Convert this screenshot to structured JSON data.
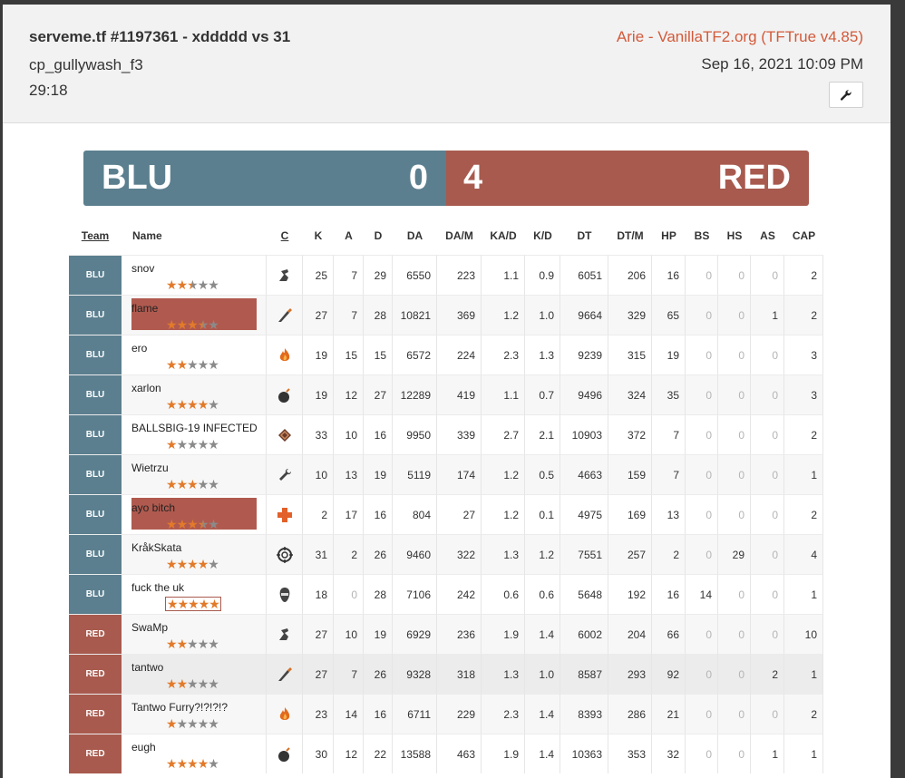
{
  "header": {
    "title": "serveme.tf #1197361 - xddddd vs 31",
    "map": "cp_gullywash_f3",
    "duration": "29:18",
    "server": "Arie - VanillaTF2.org (TFTrue v4.85)",
    "date": "Sep 16, 2021 10:09 PM",
    "tool_icon": "wrench-icon"
  },
  "score": {
    "blu_label": "BLU",
    "blu_score": "0",
    "red_score": "4",
    "red_label": "RED",
    "blu_color": "#5b7f8f",
    "red_color": "#a85a4e"
  },
  "columns": [
    "Team",
    "Name",
    "C",
    "K",
    "A",
    "D",
    "DA",
    "DA/M",
    "KA/D",
    "K/D",
    "DT",
    "DT/M",
    "HP",
    "BS",
    "HS",
    "AS",
    "CAP"
  ],
  "players": [
    {
      "team": "BLU",
      "name": "snov",
      "stars": 2.5,
      "cls": "scout-icon",
      "stats": [
        "25",
        "7",
        "29",
        "6550",
        "223",
        "1.1",
        "0.9",
        "6051",
        "206",
        "16",
        "0",
        "0",
        "0",
        "2"
      ]
    },
    {
      "team": "BLU",
      "name": "flame",
      "stars": 3.5,
      "cls": "soldier-icon",
      "stats": [
        "27",
        "7",
        "28",
        "10821",
        "369",
        "1.2",
        "1.0",
        "9664",
        "329",
        "65",
        "0",
        "0",
        "1",
        "2"
      ]
    },
    {
      "team": "BLU",
      "name": "ero",
      "stars": 2,
      "cls": "pyro-icon",
      "stats": [
        "19",
        "15",
        "15",
        "6572",
        "224",
        "2.3",
        "1.3",
        "9239",
        "315",
        "19",
        "0",
        "0",
        "0",
        "3"
      ]
    },
    {
      "team": "BLU",
      "name": "xarlon",
      "stars": 4,
      "cls": "demoman-icon",
      "stats": [
        "19",
        "12",
        "27",
        "12289",
        "419",
        "1.1",
        "0.7",
        "9496",
        "324",
        "35",
        "0",
        "0",
        "0",
        "3"
      ]
    },
    {
      "team": "BLU",
      "name": "BALLSBIG-19 INFECTED",
      "stars": 1,
      "cls": "heavy-icon",
      "stats": [
        "33",
        "10",
        "16",
        "9950",
        "339",
        "2.7",
        "2.1",
        "10903",
        "372",
        "7",
        "0",
        "0",
        "0",
        "2"
      ]
    },
    {
      "team": "BLU",
      "name": "Wietrzu",
      "stars": 3,
      "cls": "engineer-icon",
      "stats": [
        "10",
        "13",
        "19",
        "5119",
        "174",
        "1.2",
        "0.5",
        "4663",
        "159",
        "7",
        "0",
        "0",
        "0",
        "1"
      ]
    },
    {
      "team": "BLU",
      "name": "ayo bitch",
      "stars": 3.5,
      "cls": "medic-icon",
      "stats": [
        "2",
        "17",
        "16",
        "804",
        "27",
        "1.2",
        "0.1",
        "4975",
        "169",
        "13",
        "0",
        "0",
        "0",
        "2"
      ]
    },
    {
      "team": "BLU",
      "name": "KråkSkata",
      "stars": 4,
      "cls": "sniper-icon",
      "stats": [
        "31",
        "2",
        "26",
        "9460",
        "322",
        "1.3",
        "1.2",
        "7551",
        "257",
        "2",
        "0",
        "29",
        "0",
        "4"
      ]
    },
    {
      "team": "BLU",
      "name": "fuck the uk",
      "stars": 5,
      "cls": "spy-icon",
      "stats": [
        "18",
        "0",
        "28",
        "7106",
        "242",
        "0.6",
        "0.6",
        "5648",
        "192",
        "16",
        "14",
        "0",
        "0",
        "1"
      ]
    },
    {
      "team": "RED",
      "name": "SwaMp",
      "stars": 2,
      "cls": "scout-icon",
      "stats": [
        "27",
        "10",
        "19",
        "6929",
        "236",
        "1.9",
        "1.4",
        "6002",
        "204",
        "66",
        "0",
        "0",
        "0",
        "10"
      ]
    },
    {
      "team": "RED",
      "name": "tantwo",
      "stars": 2,
      "cls": "soldier-icon",
      "stats": [
        "27",
        "7",
        "26",
        "9328",
        "318",
        "1.3",
        "1.0",
        "8587",
        "293",
        "92",
        "0",
        "0",
        "2",
        "1"
      ]
    },
    {
      "team": "RED",
      "name": "Tantwo Furry?!?!?!?",
      "stars": 1,
      "cls": "pyro-icon",
      "stats": [
        "23",
        "14",
        "16",
        "6711",
        "229",
        "2.3",
        "1.4",
        "8393",
        "286",
        "21",
        "0",
        "0",
        "0",
        "2"
      ]
    },
    {
      "team": "RED",
      "name": "eugh",
      "stars": 4,
      "cls": "demoman-icon",
      "stats": [
        "30",
        "12",
        "22",
        "13588",
        "463",
        "1.9",
        "1.4",
        "10363",
        "353",
        "32",
        "0",
        "0",
        "1",
        "1"
      ]
    }
  ]
}
